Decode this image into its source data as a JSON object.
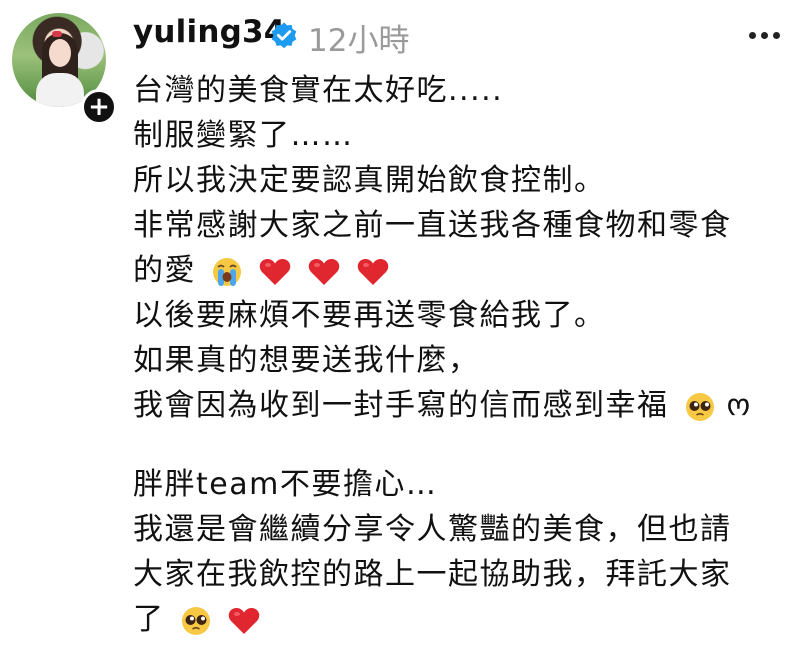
{
  "post": {
    "username": "yuling34",
    "time": "12小時",
    "lines": [
      "台灣的美食實在太好吃.....",
      "制服變緊了……",
      "所以我決定要認真開始飲食控制。",
      "非常感謝大家之前一直送我各種食物和零食",
      "的愛",
      "以後要麻煩不要再送零食給我了。",
      "如果真的想要送我什麼，",
      "我會因為收到一封手寫的信而感到幸福",
      "胖胖team不要擔心…",
      "我還是會繼續分享令人驚豔的美食，但也請",
      "大家在我飲控的路上一起協助我，拜託大家",
      "了"
    ],
    "tail_symbol": "ო",
    "icons": {
      "verified": "verified-badge-icon",
      "more": "more-options-icon",
      "follow": "follow-plus-icon",
      "heart": "red-heart-emoji",
      "cry": "loudly-crying-face-emoji",
      "plead": "pleading-face-emoji"
    },
    "colors": {
      "verified": "#1d9bf0",
      "time": "#9a9a9a",
      "heart": "#e0262f",
      "emoji_yellow": "#f7c844"
    }
  }
}
